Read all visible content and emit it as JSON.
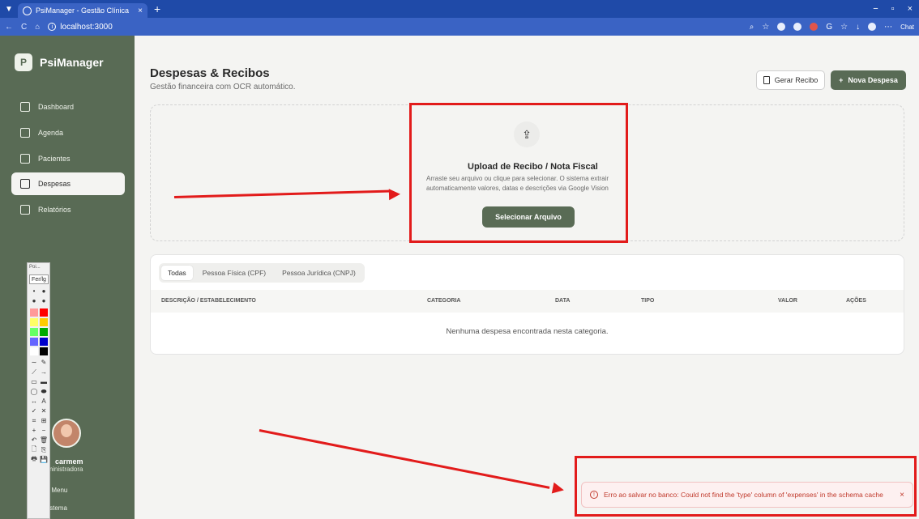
{
  "browser": {
    "tab_title": "PsiManager - Gestão Clínica",
    "tab_close": "×",
    "new_tab": "+",
    "url": "localhost:3000",
    "url_info": "i",
    "extension_label": "Chat",
    "window_controls": [
      "−",
      "▫",
      "×"
    ]
  },
  "sidebar": {
    "brand_logo": "P",
    "brand_name": "PsiManager",
    "items": [
      {
        "label": "Dashboard"
      },
      {
        "label": "Agenda"
      },
      {
        "label": "Pacientes"
      },
      {
        "label": "Despesas",
        "active": true
      },
      {
        "label": "Relatórios"
      }
    ],
    "user_name": "carmem",
    "user_role": "dministradora",
    "link_menu": "er Menu",
    "link_sistema": "Sistema"
  },
  "paint_toolbar": {
    "title": "Poi...",
    "button": "Fer/lg",
    "colors": [
      "#ff9999",
      "#ff0000",
      "#ffff66",
      "#ffcc00",
      "#66ff66",
      "#00aa00",
      "#6666ff",
      "#0000cc",
      "#ffffff",
      "#000000"
    ],
    "tools": [
      "∼",
      "✎",
      "⟋",
      "→",
      "▭",
      "▬",
      "◯",
      "⬬",
      "↔",
      "A",
      "✓",
      "✕",
      "⌗",
      "⊞",
      "+",
      "−",
      "↶",
      "🗑",
      "🗋",
      "⎘",
      "🖶",
      "💾"
    ]
  },
  "main": {
    "title": "Despesas & Recibos",
    "subtitle": "Gestão financeira com OCR automático.",
    "btn_gerar": "Gerar Recibo",
    "btn_nova_icon": "+",
    "btn_nova": "Nova Despesa",
    "upload": {
      "icon": "⇪",
      "title": "Upload de Recibo / Nota Fiscal",
      "line1": "Arraste seu arquivo ou clique para selecionar. O sistema extrair",
      "line2": "automaticamente valores, datas e descrições via Google Vision",
      "button": "Selecionar Arquivo"
    },
    "tabs": [
      "Todas",
      "Pessoa Física (CPF)",
      "Pessoa Jurídica (CNPJ)"
    ],
    "columns": [
      "DESCRIÇÃO / ESTABELECIMENTO",
      "CATEGORIA",
      "DATA",
      "TIPO",
      "VALOR",
      "AÇÕES"
    ],
    "empty_message": "Nenhuma despesa encontrada nesta categoria."
  },
  "toast": {
    "icon": "!",
    "message": "Erro ao salvar no banco: Could not find the 'type' column of 'expenses' in the schema cache",
    "close": "×"
  },
  "colors": {
    "sidebar": "#596b55",
    "accent": "#596b55",
    "annotation": "#e21b1b",
    "error": "#c0392b"
  }
}
